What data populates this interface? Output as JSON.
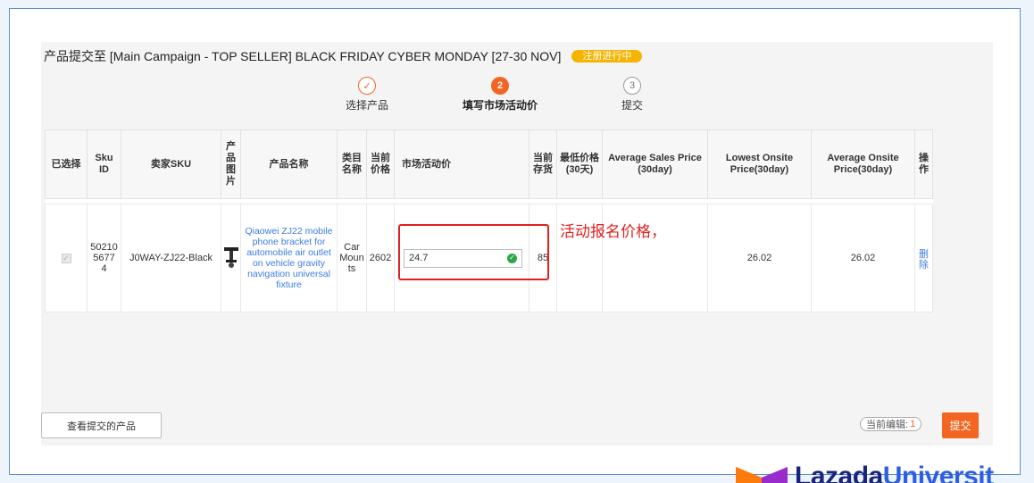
{
  "header": {
    "title": "产品提交至 [Main Campaign - TOP SELLER] BLACK FRIDAY CYBER MONDAY [27-30 NOV]",
    "badge": "注册进行中"
  },
  "steps": [
    {
      "num": "✓",
      "label": "选择产品",
      "state": "done"
    },
    {
      "num": "2",
      "label": "填写市场活动价",
      "state": "active"
    },
    {
      "num": "3",
      "label": "提交",
      "state": "todo"
    }
  ],
  "table": {
    "headers": {
      "selected": "已选择",
      "sku_id": "Sku ID",
      "seller_sku": "卖家SKU",
      "image": "产品图片",
      "name": "产品名称",
      "category": "类目名称",
      "current_price": "当前价格",
      "campaign_price": "市场活动价",
      "current_stock": "当前存货",
      "lowest_price": "最低价格(30天)",
      "avg_sales_price": "Average Sales Price (30day)",
      "lowest_onsite": "Lowest Onsite Price(30day)",
      "avg_onsite": "Average Onsite Price(30day)",
      "ops": "操作"
    },
    "row": {
      "sku_id": "502105677 4",
      "seller_sku": "J0WAY-ZJ22-Black",
      "name": "Qiaowei ZJ22 mobile phone bracket for automobile air outlet on vehicle gravity navigation universal fixture",
      "category": "Car Mounts",
      "current_price": "2602",
      "campaign_price": "24.7",
      "current_stock": "85",
      "lowest_price": "",
      "avg_sales_price": "",
      "lowest_onsite": "26.02",
      "avg_onsite": "26.02",
      "delete": "删除"
    }
  },
  "annotation": "活动报名价格，",
  "footer": {
    "view_submitted": "查看提交的产品",
    "editing_label": "当前编辑:",
    "editing_count": "1",
    "submit": "提交"
  },
  "logo": {
    "brand": "Lazada",
    "suffix": "Universit"
  },
  "colors": {
    "accent": "#f26522",
    "link": "#3b7de0",
    "annotation": "#e02020",
    "badge": "#f5b400"
  }
}
